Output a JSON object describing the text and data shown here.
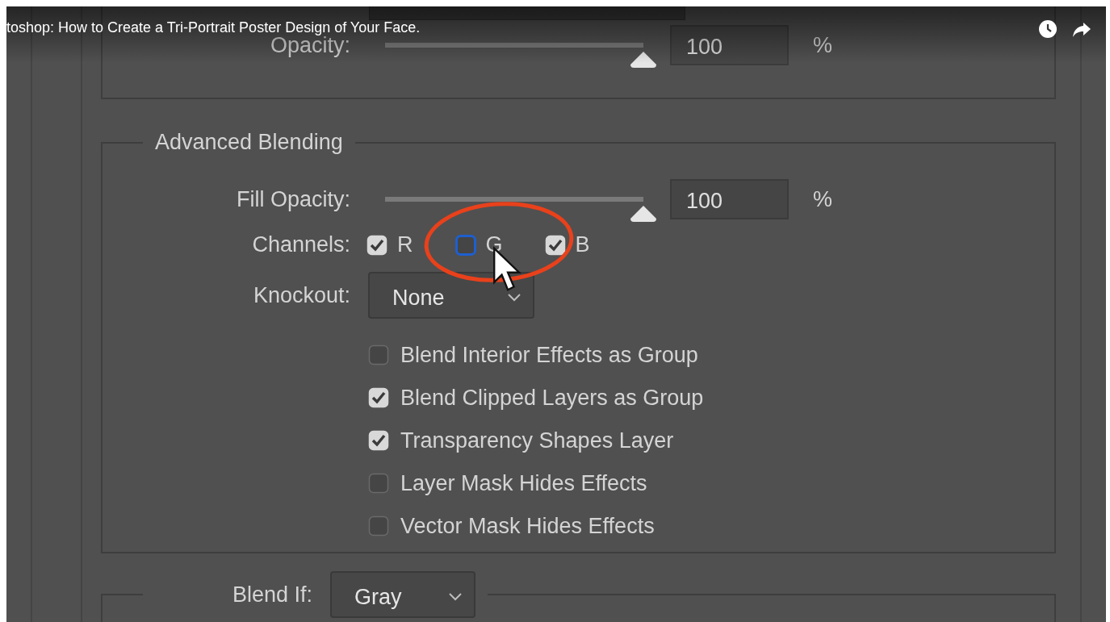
{
  "video_title": "toshop: How to Create a Tri-Portrait Poster Design of Your Face.",
  "opacity": {
    "label": "Opacity:",
    "level": 1,
    "value": "100",
    "unit": "%"
  },
  "advanced_blending": {
    "title": "Advanced Blending",
    "fill_opacity": {
      "label": "Fill Opacity:",
      "level": 1,
      "value": "100",
      "unit": "%"
    },
    "channels": {
      "label": "Channels:",
      "items": [
        {
          "label": "R",
          "checked": true,
          "focused": false
        },
        {
          "label": "G",
          "checked": false,
          "focused": true
        },
        {
          "label": "B",
          "checked": true,
          "focused": false
        }
      ]
    },
    "knockout": {
      "label": "Knockout:",
      "value": "None"
    },
    "options": [
      {
        "label": "Blend Interior Effects as Group",
        "checked": false
      },
      {
        "label": "Blend Clipped Layers as Group",
        "checked": true
      },
      {
        "label": "Transparency Shapes Layer",
        "checked": true
      },
      {
        "label": "Layer Mask Hides Effects",
        "checked": false
      },
      {
        "label": "Vector Mask Hides Effects",
        "checked": false
      }
    ]
  },
  "blend_if": {
    "label": "Blend If:",
    "value": "Gray"
  }
}
